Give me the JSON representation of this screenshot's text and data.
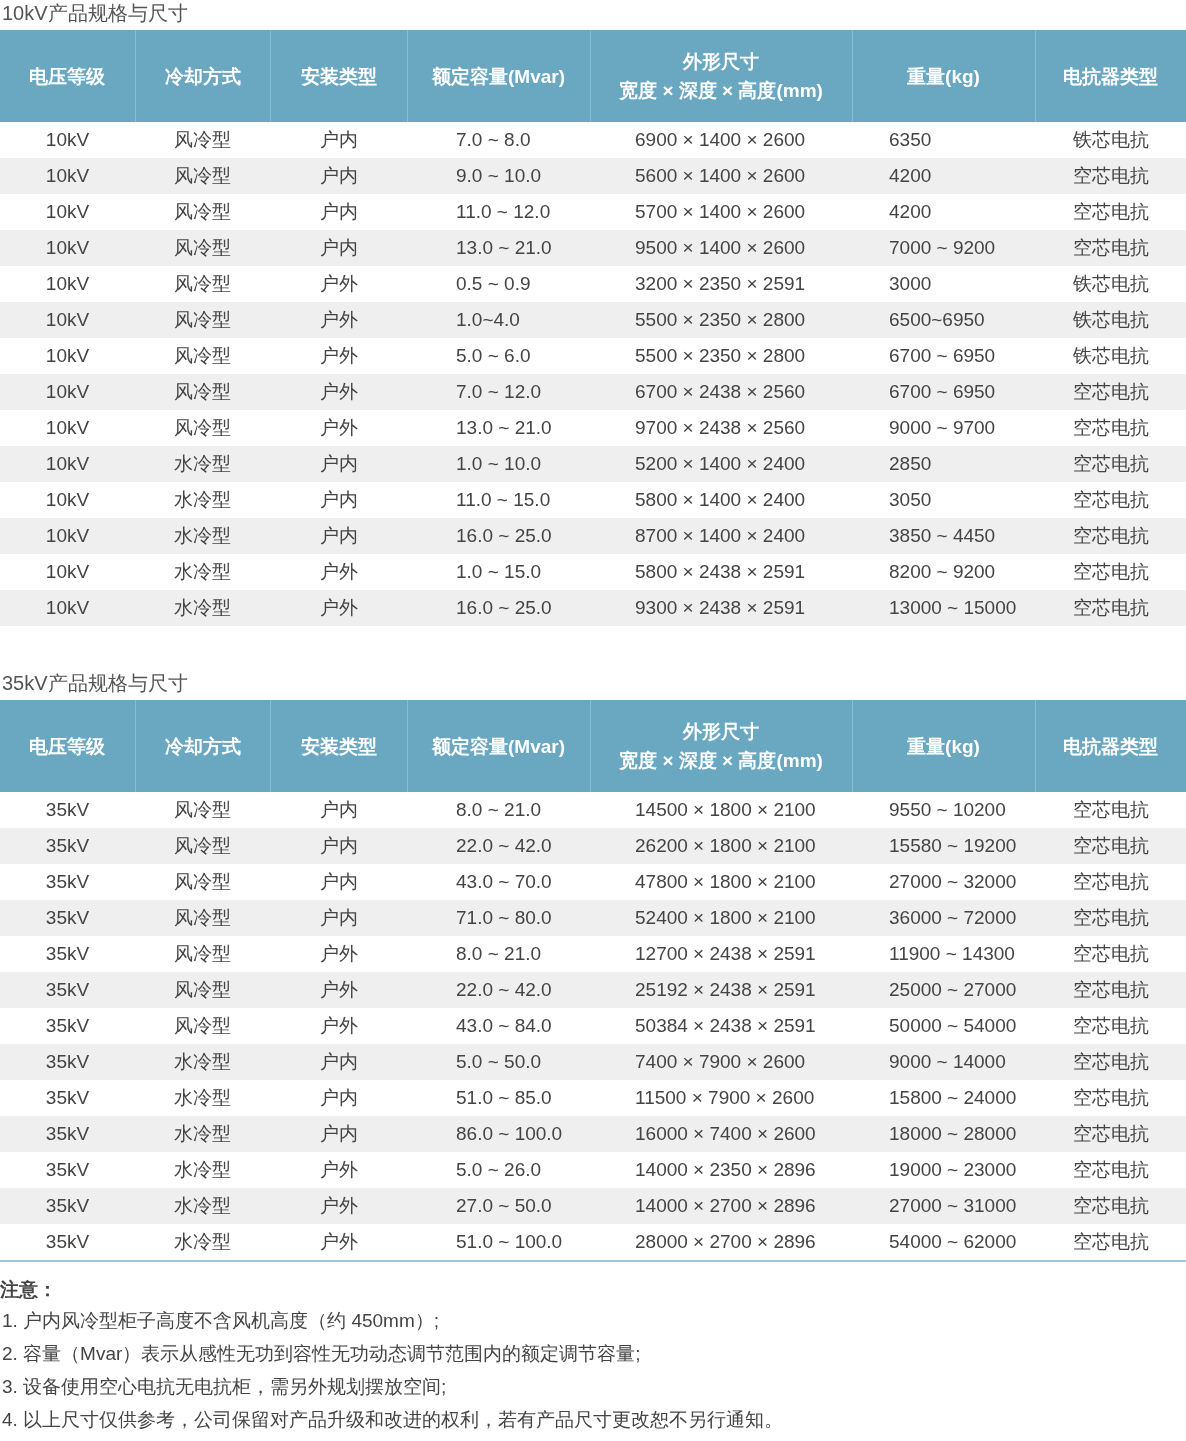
{
  "sections": [
    {
      "title": "10kV产品规格与尺寸",
      "columns": [
        {
          "label": "电压等级"
        },
        {
          "label": "冷却方式"
        },
        {
          "label": "安装类型"
        },
        {
          "label": "额定容量(Mvar)"
        },
        {
          "label": "外形尺寸",
          "sublabel": "宽度 × 深度 × 高度(mm)"
        },
        {
          "label": "重量(kg)"
        },
        {
          "label": "电抗器类型"
        }
      ],
      "rows": [
        [
          "10kV",
          "风冷型",
          "户内",
          "7.0 ~ 8.0",
          "6900 × 1400 × 2600",
          "6350",
          "铁芯电抗"
        ],
        [
          "10kV",
          "风冷型",
          "户内",
          "9.0 ~ 10.0",
          "5600 × 1400 × 2600",
          "4200",
          "空芯电抗"
        ],
        [
          "10kV",
          "风冷型",
          "户内",
          "11.0 ~ 12.0",
          "5700 × 1400 × 2600",
          "4200",
          "空芯电抗"
        ],
        [
          "10kV",
          "风冷型",
          "户内",
          "13.0 ~ 21.0",
          "9500 × 1400 × 2600",
          "7000 ~ 9200",
          "空芯电抗"
        ],
        [
          "10kV",
          "风冷型",
          "户外",
          "0.5 ~ 0.9",
          "3200 × 2350 × 2591",
          "3000",
          "铁芯电抗"
        ],
        [
          "10kV",
          "风冷型",
          "户外",
          "1.0~4.0",
          "5500 × 2350 × 2800",
          "6500~6950",
          "铁芯电抗"
        ],
        [
          "10kV",
          "风冷型",
          "户外",
          "5.0 ~ 6.0",
          "5500 × 2350 × 2800",
          "6700 ~ 6950",
          "铁芯电抗"
        ],
        [
          "10kV",
          "风冷型",
          "户外",
          "7.0 ~ 12.0",
          "6700 × 2438 × 2560",
          "6700 ~ 6950",
          "空芯电抗"
        ],
        [
          "10kV",
          "风冷型",
          "户外",
          "13.0 ~ 21.0",
          "9700 × 2438 × 2560",
          "9000 ~ 9700",
          "空芯电抗"
        ],
        [
          "10kV",
          "水冷型",
          "户内",
          "1.0 ~ 10.0",
          "5200 × 1400 × 2400",
          "2850",
          "空芯电抗"
        ],
        [
          "10kV",
          "水冷型",
          "户内",
          "11.0 ~ 15.0",
          "5800 × 1400 × 2400",
          "3050",
          "空芯电抗"
        ],
        [
          "10kV",
          "水冷型",
          "户内",
          "16.0 ~ 25.0",
          "8700 × 1400 × 2400",
          "3850 ~ 4450",
          "空芯电抗"
        ],
        [
          "10kV",
          "水冷型",
          "户外",
          "1.0 ~ 15.0",
          "5800 × 2438 × 2591",
          "8200 ~ 9200",
          "空芯电抗"
        ],
        [
          "10kV",
          "水冷型",
          "户外",
          "16.0 ~ 25.0",
          "9300 × 2438 × 2591",
          "13000 ~ 15000",
          "空芯电抗"
        ]
      ]
    },
    {
      "title": "35kV产品规格与尺寸",
      "columns": [
        {
          "label": "电压等级"
        },
        {
          "label": "冷却方式"
        },
        {
          "label": "安装类型"
        },
        {
          "label": "额定容量(Mvar)"
        },
        {
          "label": "外形尺寸",
          "sublabel": "宽度 × 深度 × 高度(mm)"
        },
        {
          "label": "重量(kg)"
        },
        {
          "label": "电抗器类型"
        }
      ],
      "rows": [
        [
          "35kV",
          "风冷型",
          "户内",
          "8.0 ~ 21.0",
          "14500 × 1800 × 2100",
          "9550 ~ 10200",
          "空芯电抗"
        ],
        [
          "35kV",
          "风冷型",
          "户内",
          "22.0 ~ 42.0",
          "26200 × 1800 × 2100",
          "15580 ~ 19200",
          "空芯电抗"
        ],
        [
          "35kV",
          "风冷型",
          "户内",
          "43.0 ~ 70.0",
          "47800 × 1800 × 2100",
          "27000 ~ 32000",
          "空芯电抗"
        ],
        [
          "35kV",
          "风冷型",
          "户内",
          "71.0 ~ 80.0",
          "52400 × 1800 × 2100",
          "36000 ~ 72000",
          "空芯电抗"
        ],
        [
          "35kV",
          "风冷型",
          "户外",
          "8.0 ~ 21.0",
          "12700 × 2438 × 2591",
          "11900 ~ 14300",
          "空芯电抗"
        ],
        [
          "35kV",
          "风冷型",
          "户外",
          "22.0 ~ 42.0",
          "25192 × 2438 × 2591",
          "25000 ~ 27000",
          "空芯电抗"
        ],
        [
          "35kV",
          "风冷型",
          "户外",
          "43.0 ~ 84.0",
          "50384 × 2438 × 2591",
          "50000 ~ 54000",
          "空芯电抗"
        ],
        [
          "35kV",
          "水冷型",
          "户内",
          "5.0 ~ 50.0",
          "7400 × 7900 × 2600",
          "9000 ~ 14000",
          "空芯电抗"
        ],
        [
          "35kV",
          "水冷型",
          "户内",
          "51.0 ~ 85.0",
          "11500 × 7900 × 2600",
          "15800 ~ 24000",
          "空芯电抗"
        ],
        [
          "35kV",
          "水冷型",
          "户内",
          "86.0 ~ 100.0",
          "16000 × 7400 × 2600",
          "18000 ~ 28000",
          "空芯电抗"
        ],
        [
          "35kV",
          "水冷型",
          "户外",
          "5.0 ~ 26.0",
          "14000 × 2350 × 2896",
          "19000 ~ 23000",
          "空芯电抗"
        ],
        [
          "35kV",
          "水冷型",
          "户外",
          "27.0 ~ 50.0",
          "14000 × 2700 × 2896",
          "27000 ~ 31000",
          "空芯电抗"
        ],
        [
          "35kV",
          "水冷型",
          "户外",
          "51.0 ~ 100.0",
          "28000 × 2700 × 2896",
          "54000 ~ 62000",
          "空芯电抗"
        ]
      ]
    }
  ],
  "notes": {
    "heading": "注意：",
    "items": [
      "1. 户内风冷型柜子高度不含风机高度（约 450mm）;",
      "2. 容量（Mvar）表示从感性无功到容性无功动态调节范围内的额定调节容量;",
      "3. 设备使用空心电抗无电抗柜，需另外规划摆放空间;",
      "4. 以上尺寸仅供参考，公司保留对产品升级和改进的权利，若有产品尺寸更改恕不另行通知。"
    ]
  }
}
